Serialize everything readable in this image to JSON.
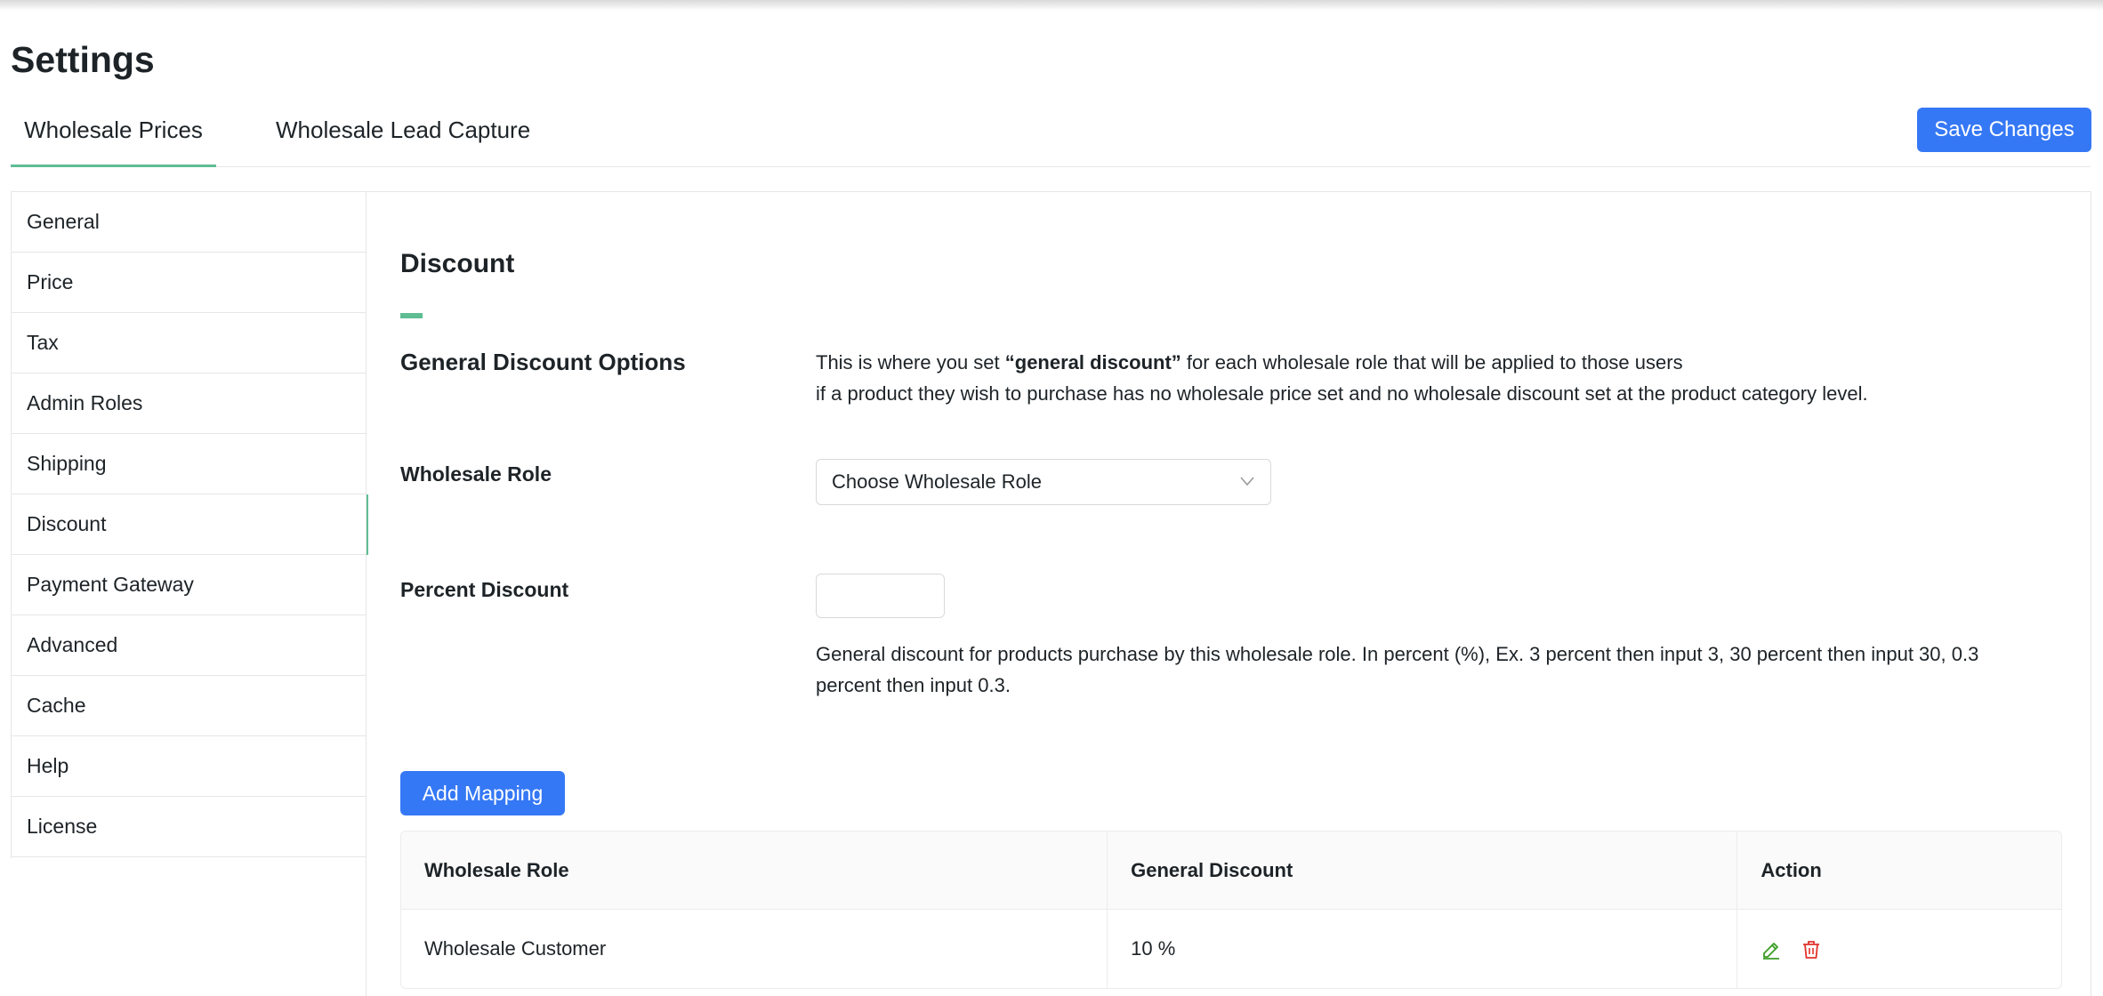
{
  "page": {
    "title": "Settings"
  },
  "tabs": [
    {
      "label": "Wholesale Prices",
      "active": true
    },
    {
      "label": "Wholesale Lead Capture",
      "active": false
    }
  ],
  "toolbar": {
    "save_label": "Save Changes"
  },
  "sidebar": {
    "items": [
      {
        "label": "General"
      },
      {
        "label": "Price"
      },
      {
        "label": "Tax"
      },
      {
        "label": "Admin Roles"
      },
      {
        "label": "Shipping"
      },
      {
        "label": "Discount",
        "active": true
      },
      {
        "label": "Payment Gateway"
      },
      {
        "label": "Advanced"
      },
      {
        "label": "Cache"
      },
      {
        "label": "Help"
      },
      {
        "label": "License"
      }
    ]
  },
  "main": {
    "section_title": "Discount",
    "general_options": {
      "label": "General Discount Options",
      "desc_prefix": "This is where you set ",
      "desc_bold": "“general discount”",
      "desc_suffix": " for each wholesale role that will be applied to those users",
      "desc_line2": "if a product they wish to purchase has no wholesale price set and no wholesale discount set at the product category level."
    },
    "wholesale_role": {
      "label": "Wholesale Role",
      "selected": "Choose Wholesale Role"
    },
    "percent_discount": {
      "label": "Percent Discount",
      "value": "",
      "help_line1": "General discount for products purchase by this wholesale role. In percent (%), Ex. 3 percent then input 3, 30 percent then input 30, 0.3",
      "help_line2": "percent then input 0.3."
    },
    "add_mapping_label": "Add Mapping",
    "table": {
      "headers": [
        "Wholesale Role",
        "General Discount",
        "Action"
      ],
      "rows": [
        {
          "role": "Wholesale Customer",
          "discount": "10 %"
        }
      ]
    }
  },
  "colors": {
    "accent_green": "#5ebd93",
    "primary_blue": "#3578f5",
    "edit_icon": "#3a9d23",
    "delete_icon": "#e0332c"
  },
  "icons": {
    "select_chevron": "chevron-down-icon",
    "edit": "pencil-icon",
    "delete": "trash-icon"
  }
}
